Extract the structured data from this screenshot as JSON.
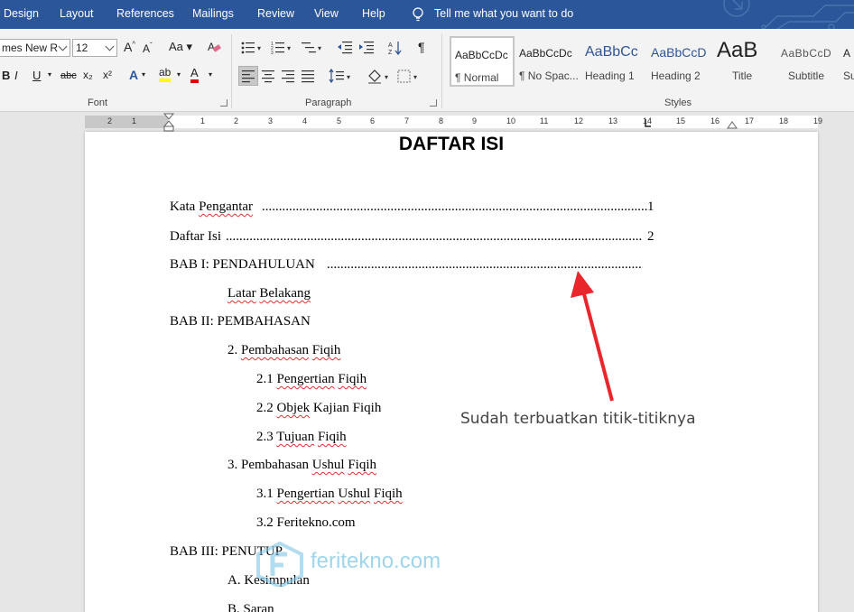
{
  "tabs": [
    "Design",
    "Layout",
    "References",
    "Mailings",
    "Review",
    "View",
    "Help"
  ],
  "tell_me": "Tell me what you want to do",
  "font": {
    "name": "mes New R",
    "size": "12",
    "group_label": "Font",
    "grow": "A",
    "shrink": "A",
    "case": "Aa",
    "bold": "B",
    "italic": "I",
    "underline": "U",
    "strike": "abc",
    "subscript": "x₂",
    "superscript": "x²",
    "effects": "A",
    "highlight": "ab",
    "font_color": "A"
  },
  "paragraph": {
    "group_label": "Paragraph",
    "pilcrow": "¶"
  },
  "styles": {
    "group_label": "Styles",
    "items": [
      {
        "preview": "AaBbCcDc",
        "name": "¶ Normal"
      },
      {
        "preview": "AaBbCcDc",
        "name": "¶ No Spac..."
      },
      {
        "preview": "AaBbCc",
        "name": "Heading 1"
      },
      {
        "preview": "AaBbCcD",
        "name": "Heading 2"
      },
      {
        "preview": "AaB",
        "name": "Title"
      },
      {
        "preview": "AaBbCcD",
        "name": "Subtitle"
      },
      {
        "preview": "A",
        "name": "Su"
      }
    ]
  },
  "ruler_numbers": [
    "2",
    "1",
    "1",
    "2",
    "3",
    "4",
    "5",
    "6",
    "7",
    "8",
    "9",
    "10",
    "11",
    "12",
    "13",
    "14",
    "15",
    "16",
    "17",
    "18",
    "19"
  ],
  "document": {
    "title": "DAFTAR ISI",
    "entries": [
      {
        "text": "Kata Pengantar",
        "page": "1"
      },
      {
        "text": "Daftar Isi",
        "page": "2"
      },
      {
        "text": "BAB I: PENDAHULUAN",
        "page": ""
      },
      {
        "text": "Latar Belakang"
      },
      {
        "text": "BAB II: PEMBAHASAN"
      },
      {
        "text": "2. Pembahasan Fiqih"
      },
      {
        "text": "2.1 Pengertian Fiqih"
      },
      {
        "text": "2.2 Objek Kajian Fiqih"
      },
      {
        "text": "2.3 Tujuan Fiqih"
      },
      {
        "text": "3. Pembahasan Ushul Fiqih"
      },
      {
        "text": "3.1 Pengertian Ushul Fiqih"
      },
      {
        "text": "3.2 Feritekno.com"
      },
      {
        "text": "BAB III: PENUTUP"
      },
      {
        "text": "A. Kesimpulan"
      },
      {
        "text": "B. Saran"
      }
    ]
  },
  "annotation": "Sudah terbuatkan titik-titiknya",
  "watermark": "feritekno.com",
  "colors": {
    "tabbar": "#2b579a",
    "arrow": "#e8262b",
    "watermark": "#7fc7e8"
  }
}
